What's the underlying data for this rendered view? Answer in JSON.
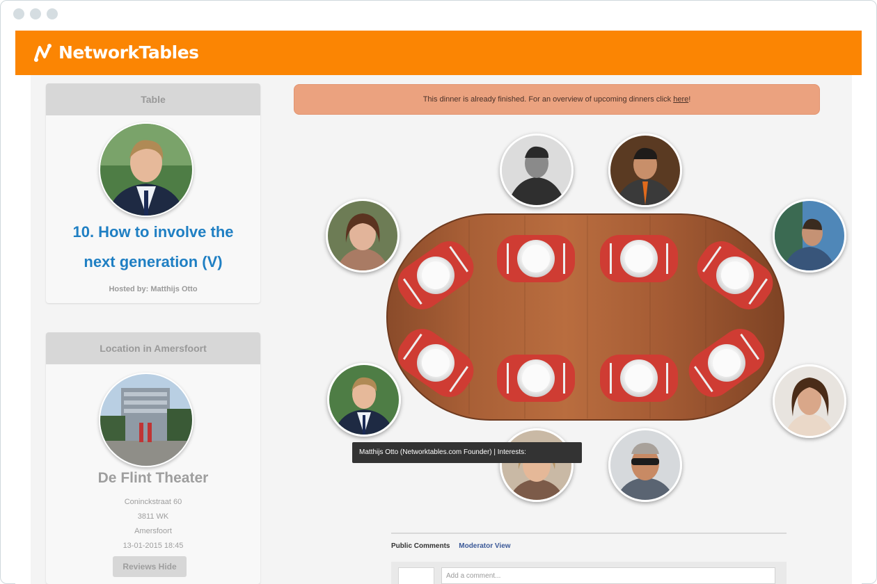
{
  "app": {
    "brand": "NetworkTables",
    "accent": "#fb8503",
    "link_color": "#1f7fc3"
  },
  "table_panel": {
    "header": "Table",
    "title_line1": "10. How to involve the",
    "title_line2": "next generation (V)",
    "hosted_by": "Hosted by: Matthijs Otto"
  },
  "location_panel": {
    "header": "Location in Amersfoort",
    "venue": "De Flint Theater",
    "street": "Coninckstraat 60",
    "postcode": "3811 WK",
    "city": "Amersfoort",
    "datetime": "13-01-2015 18:45",
    "reviews_button": "Reviews Hide"
  },
  "alert": {
    "text": "This dinner is already finished. For an overview of upcoming dinners click ",
    "link": "here",
    "suffix": "!"
  },
  "tooltip": "Matthijs Otto (Networktables.com Founder) | Interests:",
  "comments": {
    "tab_public": "Public Comments",
    "tab_moderator": "Moderator View",
    "input_placeholder": "Add a comment..."
  },
  "guests": [
    "guest-1",
    "guest-2",
    "guest-3",
    "guest-4",
    "guest-5",
    "guest-6",
    "guest-7",
    "guest-8"
  ]
}
